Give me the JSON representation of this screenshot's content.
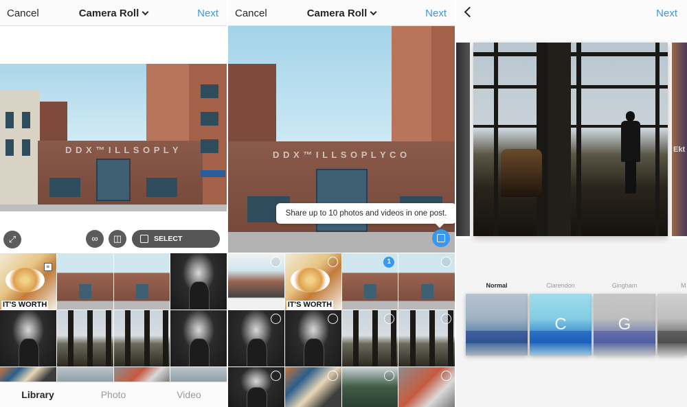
{
  "panel1": {
    "header": {
      "cancel": "Cancel",
      "title": "Camera Roll",
      "next": "Next"
    },
    "controls": {
      "select_multiple": "SELECT MULTIPLE"
    },
    "grid_text": {
      "its_worth": "IT'S WORTH"
    },
    "tabs": [
      {
        "label": "Library",
        "active": true
      },
      {
        "label": "Photo",
        "active": false
      },
      {
        "label": "Video",
        "active": false
      }
    ]
  },
  "panel2": {
    "header": {
      "cancel": "Cancel",
      "title": "Camera Roll",
      "next": "Next"
    },
    "tooltip": "Share up to 10 photos and videos in one post.",
    "selected_badge": "1",
    "grid_text": {
      "its_worth": "IT'S WORTH"
    }
  },
  "panel3": {
    "header": {
      "next": "Next"
    },
    "edge_text": "Ekt",
    "filters": [
      {
        "name": "Normal",
        "letter": "",
        "active": true
      },
      {
        "name": "Clarendon",
        "letter": "C",
        "active": false
      },
      {
        "name": "Gingham",
        "letter": "G",
        "active": false
      },
      {
        "name": "M",
        "letter": "",
        "active": false
      }
    ]
  },
  "colors": {
    "accent": "#3897f0",
    "text": "#262626",
    "muted": "#999999"
  },
  "icons": [
    "chevron-down-icon",
    "expand-icon",
    "boomerang-icon",
    "layout-icon",
    "multi-select-icon",
    "back-icon",
    "list-icon"
  ]
}
